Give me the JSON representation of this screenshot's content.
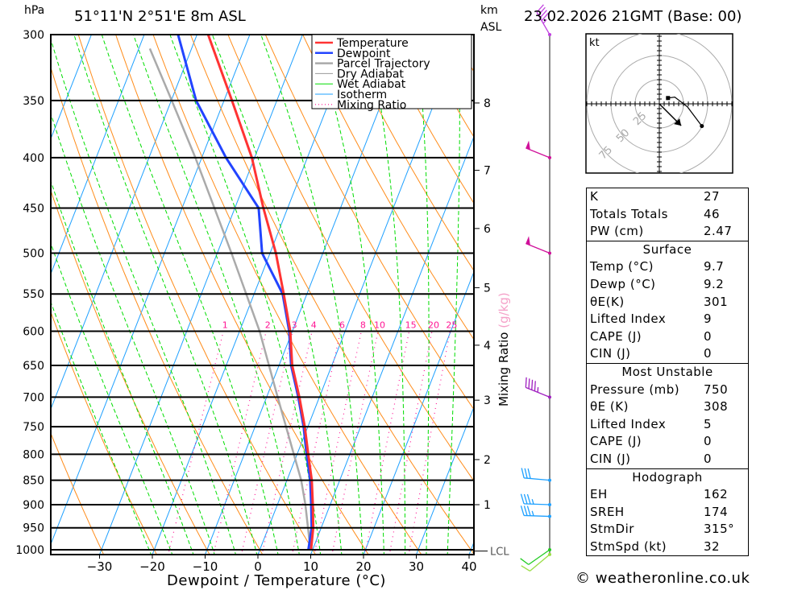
{
  "header": {
    "pressure_unit": "hPa",
    "location": "51°11'N 2°51'E 8m ASL",
    "height_unit": "km",
    "height_unit2": "ASL",
    "datetime": "23.02.2026 21GMT (Base: 00)"
  },
  "colors": {
    "temperature": "#ff3333",
    "dewpoint": "#2244ff",
    "parcel": "#aaaaaa",
    "dry_adiabat": "#ff8c1a",
    "wet_adiabat": "#00dd00",
    "isotherm": "#1ea0ff",
    "mixing_ratio": "#ff1493"
  },
  "chart_data": {
    "type": "line",
    "subtype": "skew-t log-p",
    "xlabel": "Dewpoint / Temperature (°C)",
    "ylabel": "hPa",
    "xticks": [
      -30,
      -20,
      -10,
      0,
      10,
      20,
      30,
      40
    ],
    "pressure_levels": [
      300,
      350,
      400,
      450,
      500,
      550,
      600,
      650,
      700,
      750,
      800,
      850,
      900,
      950,
      1000
    ],
    "pressure_range": [
      1011,
      300
    ],
    "legend": {
      "placement": "top-right",
      "entries": [
        "Temperature",
        "Dewpoint",
        "Parcel Trajectory",
        "Dry Adiabat",
        "Wet Adiabat",
        "Isotherm",
        "Mixing Ratio"
      ]
    },
    "series": [
      {
        "name": "Temperature",
        "pressure": [
          1000,
          950,
          900,
          850,
          800,
          750,
          700,
          650,
          600,
          550,
          500,
          450,
          400,
          350,
          300
        ],
        "values": [
          9.7,
          8.5,
          6.7,
          4.7,
          2.1,
          -0.6,
          -3.8,
          -7.5,
          -10.4,
          -14.4,
          -18.9,
          -24.6,
          -30.5,
          -38.5,
          -47.9
        ]
      },
      {
        "name": "Dewpoint",
        "pressure": [
          1000,
          950,
          900,
          850,
          800,
          750,
          700,
          650,
          600,
          550,
          500,
          450,
          400,
          350,
          300
        ],
        "values": [
          9.2,
          8.2,
          6.4,
          4.4,
          1.8,
          -0.8,
          -4.0,
          -7.7,
          -10.6,
          -14.6,
          -21.5,
          -25.5,
          -35.4,
          -45.3,
          -53.6
        ]
      },
      {
        "name": "Parcel Trajectory",
        "pressure": [
          1000,
          900,
          850,
          700,
          600,
          500,
          400,
          350,
          310
        ],
        "values": [
          9.6,
          5.3,
          2.7,
          -7.9,
          -16.2,
          -27.3,
          -41.2,
          -49.9,
          -57.9
        ]
      }
    ],
    "mixing_ratio_label": "Mixing Ratio (g/kg)",
    "mixing_ratio_lines": [
      1,
      2,
      3,
      4,
      6,
      8,
      10,
      15,
      20,
      25
    ],
    "height_axis": {
      "labels": [
        "8",
        "7",
        "6",
        "5",
        "4",
        "3",
        "2",
        "1"
      ],
      "pressures": [
        352,
        412,
        472,
        542,
        620,
        705,
        810,
        900
      ],
      "lcl_label": "LCL",
      "lcl_pressure": 1003
    },
    "wind_barbs": [
      {
        "pressure": 300,
        "dir": 330,
        "speed": 45,
        "color": "#c040e0"
      },
      {
        "pressure": 400,
        "dir": 292,
        "speed": 50,
        "color": "#d0109a"
      },
      {
        "pressure": 500,
        "dir": 292,
        "speed": 50,
        "color": "#d0109a"
      },
      {
        "pressure": 700,
        "dir": 292,
        "speed": 45,
        "color": "#a020c0"
      },
      {
        "pressure": 850,
        "dir": 275,
        "speed": 30,
        "color": "#1ea0ff"
      },
      {
        "pressure": 900,
        "dir": 272,
        "speed": 35,
        "color": "#1ea0ff"
      },
      {
        "pressure": 925,
        "dir": 272,
        "speed": 35,
        "color": "#1ea0ff"
      },
      {
        "pressure": 1000,
        "dir": 235,
        "speed": 10,
        "color": "#22cc22"
      },
      {
        "pressure": 1011,
        "dir": 230,
        "speed": 10,
        "color": "#99dd44"
      }
    ],
    "hodograph": {
      "unit": "kt",
      "rings": [
        25,
        50,
        75
      ],
      "points": [
        {
          "u": 9,
          "v": 6
        },
        {
          "u": 16,
          "v": 7
        },
        {
          "u": 29,
          "v": -3
        },
        {
          "u": 44,
          "v": -23
        }
      ],
      "storm_motion": {
        "u": 22.6,
        "v": -22.6
      }
    }
  },
  "indices": {
    "general": [
      {
        "label": "K",
        "value": "27"
      },
      {
        "label": "Totals Totals",
        "value": "46"
      },
      {
        "label": "PW (cm)",
        "value": "2.47"
      }
    ],
    "surface": {
      "title": "Surface",
      "rows": [
        {
          "label": "Temp (°C)",
          "value": "9.7"
        },
        {
          "label": "Dewp (°C)",
          "value": "9.2"
        },
        {
          "label": "θE(K)",
          "value": "301"
        },
        {
          "label": "Lifted Index",
          "value": "9"
        },
        {
          "label": "CAPE (J)",
          "value": "0"
        },
        {
          "label": "CIN (J)",
          "value": "0"
        }
      ]
    },
    "most_unstable": {
      "title": "Most Unstable",
      "rows": [
        {
          "label": "Pressure (mb)",
          "value": "750"
        },
        {
          "label": "θE (K)",
          "value": "308"
        },
        {
          "label": "Lifted Index",
          "value": "5"
        },
        {
          "label": "CAPE (J)",
          "value": "0"
        },
        {
          "label": "CIN (J)",
          "value": "0"
        }
      ]
    },
    "hodograph": {
      "title": "Hodograph",
      "rows": [
        {
          "label": "EH",
          "value": "162"
        },
        {
          "label": "SREH",
          "value": "174"
        },
        {
          "label": "StmDir",
          "value": "315°"
        },
        {
          "label": "StmSpd (kt)",
          "value": "32"
        }
      ]
    }
  },
  "footer": "© weatheronline.co.uk"
}
